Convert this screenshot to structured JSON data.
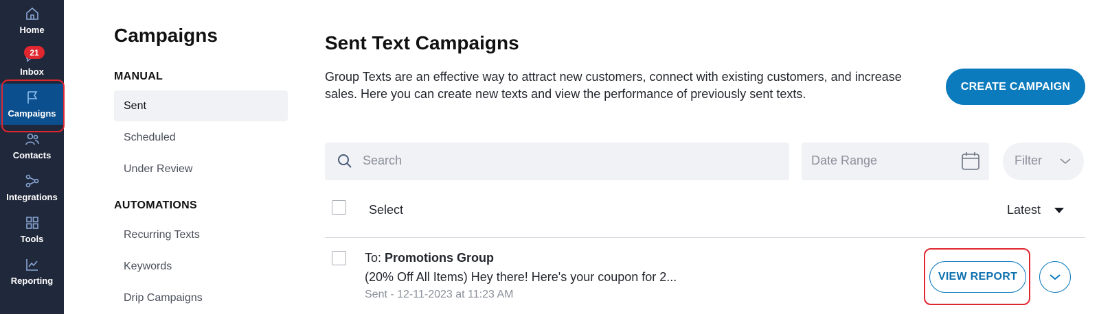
{
  "nav": {
    "items": [
      {
        "label": "Home",
        "icon": "home-icon"
      },
      {
        "label": "Inbox",
        "icon": "chat-icon",
        "badge": "21"
      },
      {
        "label": "Campaigns",
        "icon": "flag-icon",
        "active": true
      },
      {
        "label": "Contacts",
        "icon": "users-icon"
      },
      {
        "label": "Integrations",
        "icon": "integrations-icon"
      },
      {
        "label": "Tools",
        "icon": "grid-icon"
      },
      {
        "label": "Reporting",
        "icon": "chart-icon"
      }
    ]
  },
  "sidebar": {
    "title": "Campaigns",
    "manual_heading": "MANUAL",
    "manual_items": [
      "Sent",
      "Scheduled",
      "Under Review"
    ],
    "automations_heading": "AUTOMATIONS",
    "automation_items": [
      "Recurring Texts",
      "Keywords",
      "Drip Campaigns"
    ]
  },
  "main": {
    "title": "Sent Text Campaigns",
    "description": "Group Texts are an effective way to attract new customers, connect with existing customers, and increase sales. Here you can create new texts and view the performance of previously sent texts.",
    "create_button": "CREATE CAMPAIGN",
    "search_placeholder": "Search",
    "date_range_placeholder": "Date Range",
    "filter_label": "Filter",
    "select_label": "Select",
    "sort_label": "Latest",
    "campaign": {
      "to_prefix": "To:",
      "to_group": "Promotions Group",
      "message": "(20% Off All Items) Hey there! Here's your coupon for 2...",
      "meta": "Sent - 12-11-2023 at 11:23 AM",
      "view_report": "VIEW REPORT"
    }
  },
  "colors": {
    "rail_bg": "#20283b",
    "active_bg": "#0b4f8f",
    "accent": "#0c7bbd",
    "highlight": "#e0262f"
  }
}
